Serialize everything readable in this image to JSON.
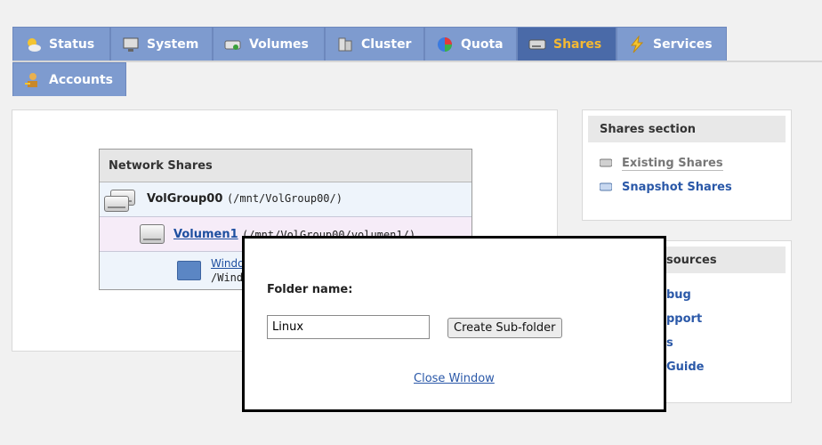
{
  "tabs": [
    {
      "label": "Status",
      "icon": "sun-cloud-icon",
      "active": false
    },
    {
      "label": "System",
      "icon": "monitor-icon",
      "active": false
    },
    {
      "label": "Volumes",
      "icon": "volume-drive-icon",
      "active": false
    },
    {
      "label": "Cluster",
      "icon": "cluster-icon",
      "active": false
    },
    {
      "label": "Quota",
      "icon": "pie-icon",
      "active": false
    },
    {
      "label": "Shares",
      "icon": "shares-drive-icon",
      "active": true
    },
    {
      "label": "Services",
      "icon": "lightning-icon",
      "active": false
    },
    {
      "label": "Accounts",
      "icon": "user-key-icon",
      "active": false
    }
  ],
  "main": {
    "table_title": "Network Shares",
    "volume_group": {
      "name": "VolGroup00",
      "path": "(/mnt/VolGroup00/)"
    },
    "volume": {
      "name": "Volumen1",
      "path": "(/mnt/VolGroup00/volumen1/)"
    },
    "share": {
      "name": "Windo",
      "path": "/Windo"
    }
  },
  "sidebar": {
    "shares_section": {
      "title": "Shares section",
      "links": [
        "Existing Shares",
        "Snapshot Shares"
      ]
    },
    "resources": {
      "title_partial": "sources",
      "links": [
        "bug",
        "pport",
        "s",
        "Guide"
      ]
    }
  },
  "modal": {
    "label": "Folder name:",
    "input_value": "Linux",
    "button_label": "Create Sub-folder",
    "close_label": "Close Window"
  },
  "colors": {
    "tab_bg": "#7e9bcf",
    "tab_active_bg": "#4a6aa8",
    "tab_active_text": "#f5b932",
    "link": "#2a58a8"
  }
}
